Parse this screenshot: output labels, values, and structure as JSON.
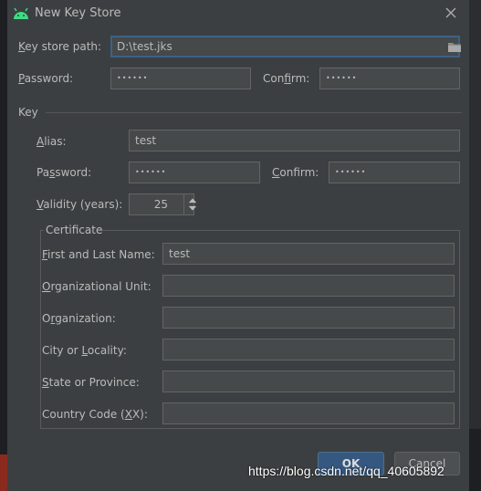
{
  "dialog": {
    "title": "New Key Store",
    "colors": {
      "background": "#3c3f41",
      "field": "#45494a",
      "focus_border": "#3d6185",
      "ok_button": "#365880",
      "android_green": "#3ddc84"
    }
  },
  "keystore": {
    "path_label_u": "K",
    "path_label_rest": "ey store path:",
    "path_value": "D:\\test.jks",
    "password_label_u": "P",
    "password_label_rest": "assword:",
    "password_value": "••••••",
    "confirm_label_pre": "Con",
    "confirm_label_u": "f",
    "confirm_label_rest": "irm:",
    "confirm_value": "••••••"
  },
  "key": {
    "section_label": "Key",
    "alias_label_u": "A",
    "alias_label_rest": "lias:",
    "alias_value": "test",
    "password_label_pre": "Pa",
    "password_label_u": "s",
    "password_label_rest": "sword:",
    "password_value": "••••••",
    "confirm_label_u": "C",
    "confirm_label_rest": "onfirm:",
    "confirm_value": "••••••",
    "validity_label_u": "V",
    "validity_label_rest": "alidity (years):",
    "validity_value": "25"
  },
  "certificate": {
    "section_label": "Certificate",
    "name_label_u": "F",
    "name_label_rest": "irst and Last Name:",
    "name_value": "test",
    "org_unit_label_u": "O",
    "org_unit_label_rest": "rganizational Unit:",
    "org_unit_value": "",
    "org_label_pre": "O",
    "org_label_u": "r",
    "org_label_rest": "ganization:",
    "org_value": "",
    "city_label_pre": "City or ",
    "city_label_u": "L",
    "city_label_rest": "ocality:",
    "city_value": "",
    "state_label_pre": "",
    "state_label_u": "S",
    "state_label_rest": "tate or Province:",
    "state_value": "",
    "country_label_pre": "Country Code (",
    "country_label_u": "X",
    "country_label_rest": "X):",
    "country_value": ""
  },
  "buttons": {
    "ok": "OK",
    "cancel": "Cancel"
  },
  "watermark": "https://blog.csdn.net/qq_40605892"
}
